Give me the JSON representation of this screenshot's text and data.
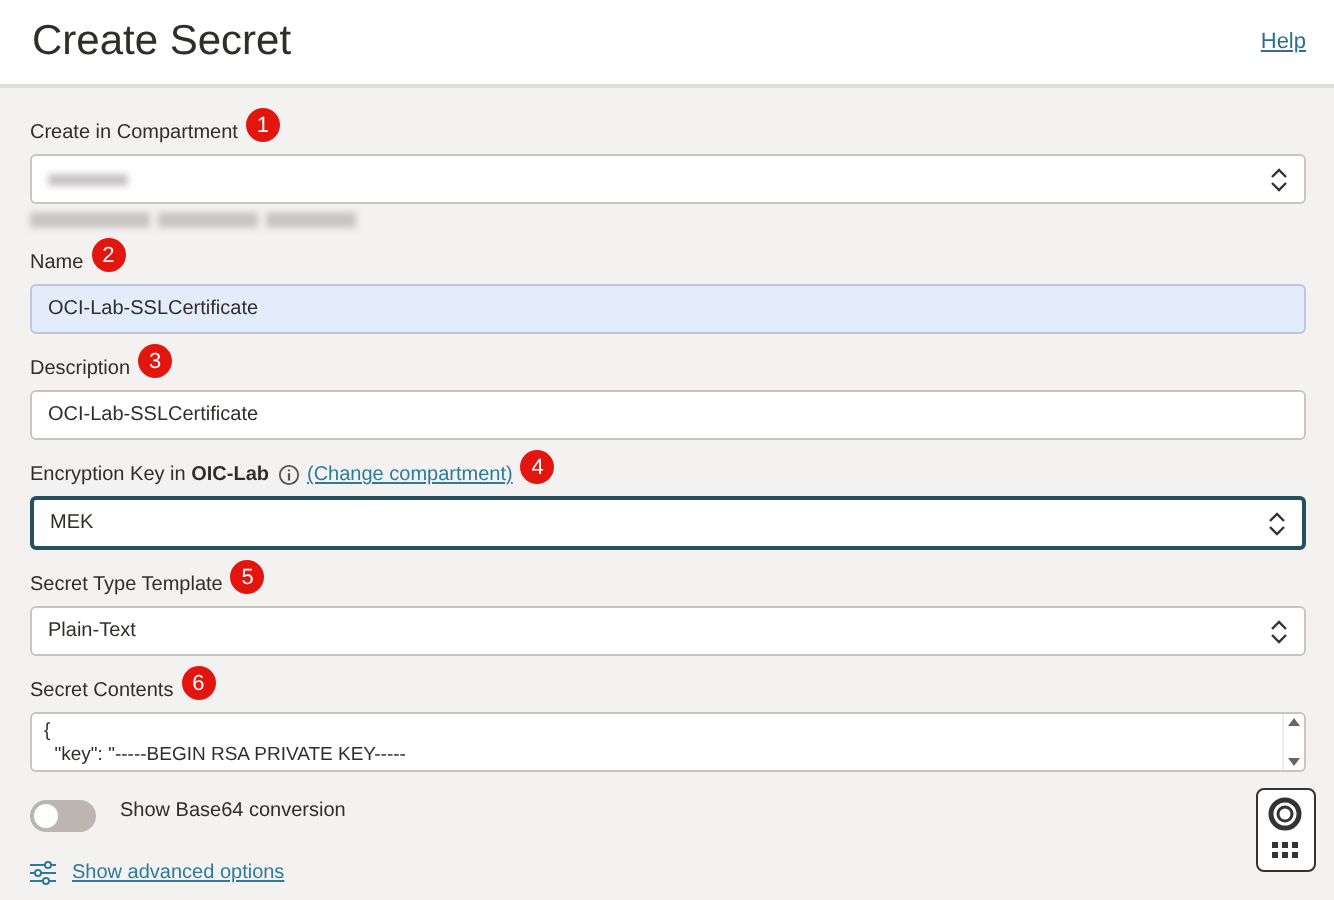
{
  "header": {
    "title": "Create Secret",
    "help_link": "Help"
  },
  "fields": [
    {
      "kind": "select",
      "label": "Create in Compartment",
      "callout": "1",
      "redacted": true
    },
    {
      "kind": "input",
      "label": "Name",
      "value": "OCI-Lab-SSLCertificate",
      "callout": "2",
      "autofilled": true
    },
    {
      "kind": "input",
      "label": "Description",
      "value": "OCI-Lab-SSLCertificate",
      "callout": "3",
      "autofilled": false
    },
    {
      "kind": "select",
      "label": "Encryption Key in",
      "label_bold": "OIC-Lab",
      "link": "(Change compartment)",
      "value": "MEK",
      "callout": "4",
      "focused": true
    },
    {
      "kind": "select",
      "label": "Secret Type Template",
      "value": "Plain-Text",
      "callout": "5",
      "focused": false
    },
    {
      "kind": "textarea",
      "label": "Secret Contents",
      "lines": [
        "{",
        "  \"key\": \"-----BEGIN RSA PRIVATE KEY-----"
      ],
      "callout": "6"
    }
  ],
  "toggle": {
    "label": "Show Base64 conversion",
    "on": false
  },
  "advanced_link": "Show advanced options"
}
